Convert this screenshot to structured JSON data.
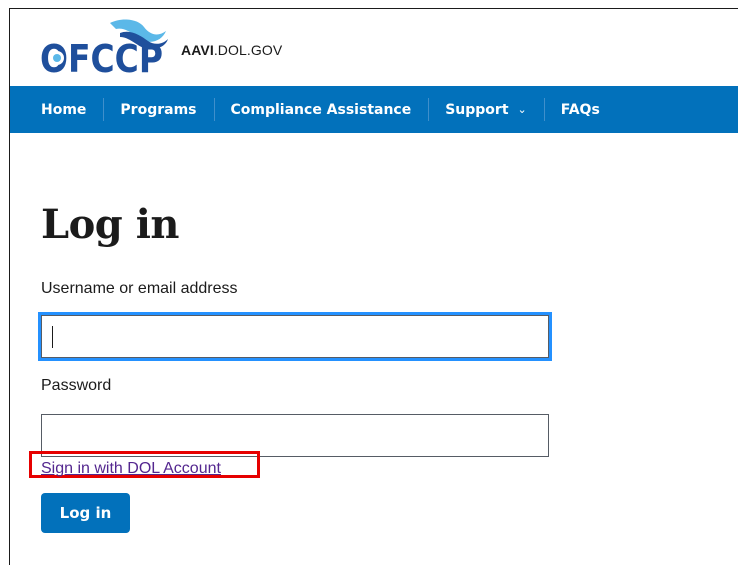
{
  "header": {
    "logo_text": "OFCCP",
    "site_name_bold": "AAVI",
    "site_name_rest": ".DOL.GOV"
  },
  "nav": {
    "items": [
      {
        "label": "Home"
      },
      {
        "label": "Programs"
      },
      {
        "label": "Compliance Assistance"
      },
      {
        "label": "Support",
        "has_dropdown": true
      },
      {
        "label": "FAQs"
      }
    ],
    "background_color": "#0271bb"
  },
  "page": {
    "title": "Log in"
  },
  "form": {
    "username_label": "Username or email address",
    "username_value": "",
    "password_label": "Password",
    "password_value": "",
    "dol_link": "Sign in with DOL Account",
    "submit_label": "Log in"
  },
  "colors": {
    "primary": "#0271bb",
    "focus": "#2491ff",
    "visited_link": "#54278f",
    "annotation": "#e60000"
  }
}
